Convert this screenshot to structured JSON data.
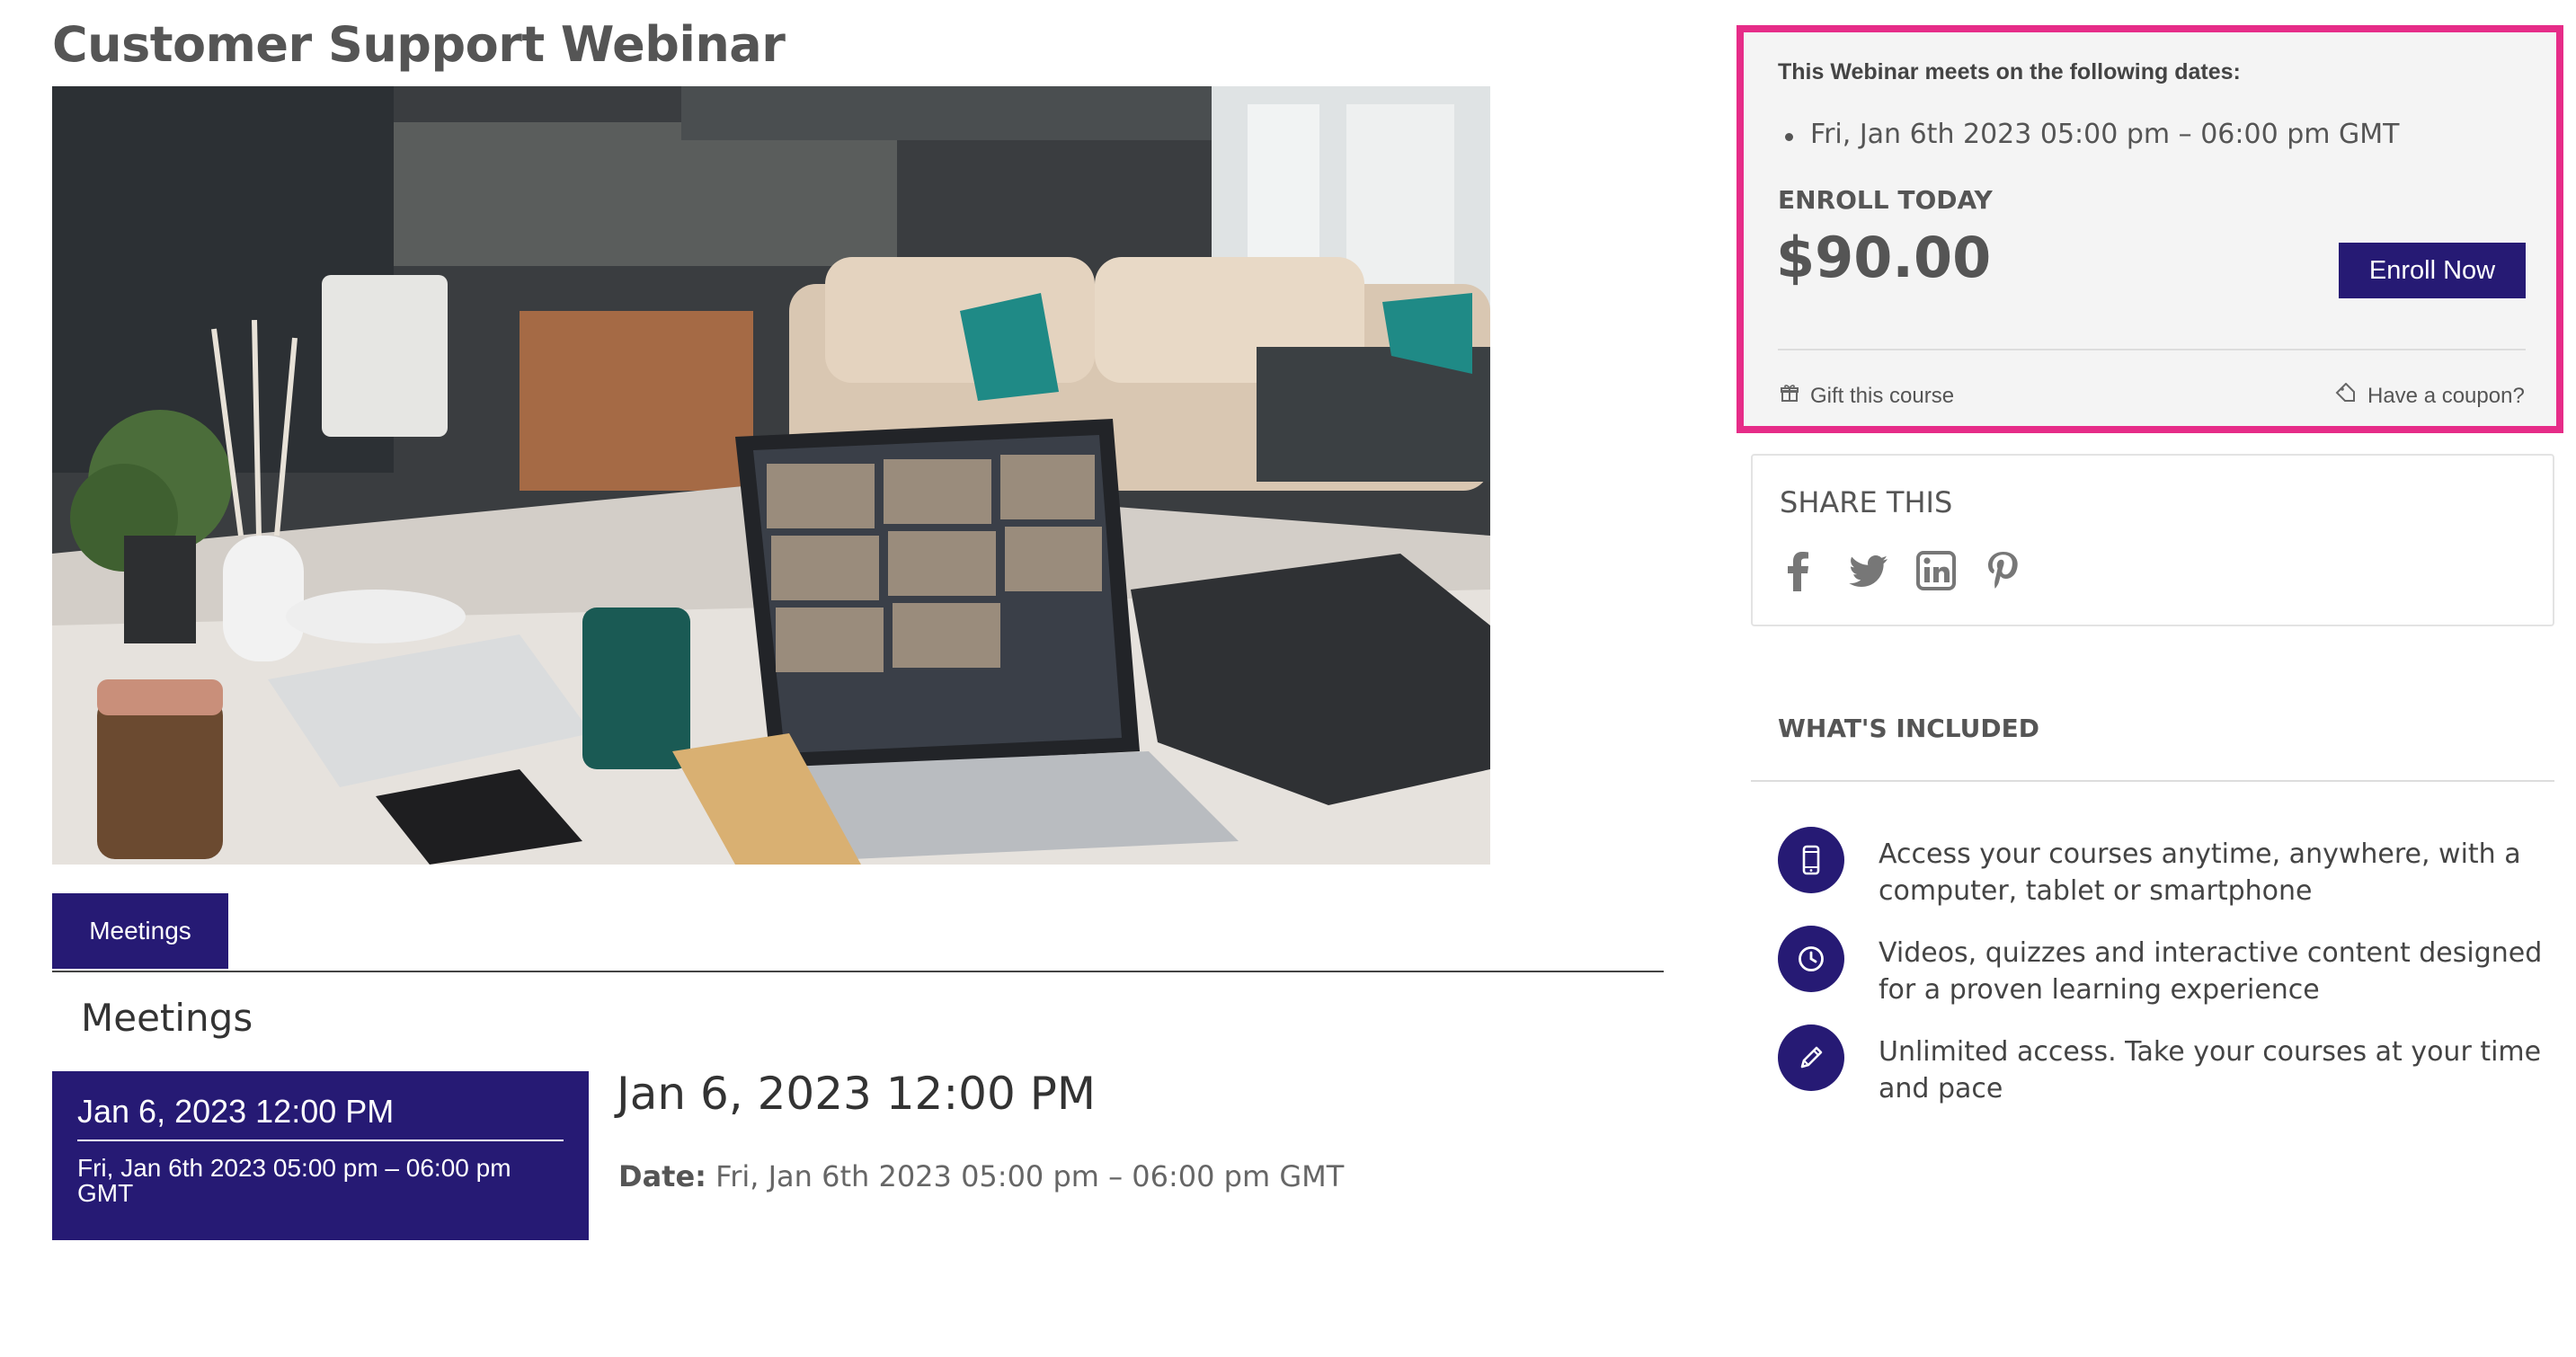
{
  "page": {
    "title": "Customer Support Webinar"
  },
  "tabs": {
    "meetings_label": "Meetings"
  },
  "meetings": {
    "heading": "Meetings",
    "card_title": "Jan 6, 2023 12:00 PM",
    "card_subtitle": "Fri, Jan 6th 2023 05:00 pm – 06:00 pm GMT",
    "detail_title": "Jan 6, 2023 12:00 PM",
    "detail_date_label": "Date:",
    "detail_date_value": "Fri, Jan 6th 2023 05:00 pm – 06:00 pm GMT"
  },
  "enroll": {
    "dates_label": "This Webinar meets on the following dates:",
    "date_item": "Fri, Jan 6th 2023 05:00 pm – 06:00 pm GMT",
    "enroll_label": "ENROLL TODAY",
    "price": "$90.00",
    "button_label": "Enroll Now",
    "gift_label": "Gift this course",
    "coupon_label": "Have a coupon?",
    "highlight_color": "#e62c88"
  },
  "share": {
    "title": "SHARE THIS",
    "icons": [
      "facebook-icon",
      "twitter-icon",
      "linkedin-icon",
      "pinterest-icon"
    ]
  },
  "included": {
    "title": "WHAT'S INCLUDED",
    "items": [
      {
        "icon": "mobile-phone-icon",
        "text": "Access your courses anytime, anywhere, with a computer, tablet or smartphone"
      },
      {
        "icon": "clock-icon",
        "text": "Videos, quizzes and interactive content designed for a proven learning experience"
      },
      {
        "icon": "pencil-icon",
        "text": "Unlimited access. Take your courses at your time and pace"
      }
    ]
  },
  "colors": {
    "brand": "#261a74",
    "text": "#555555"
  }
}
